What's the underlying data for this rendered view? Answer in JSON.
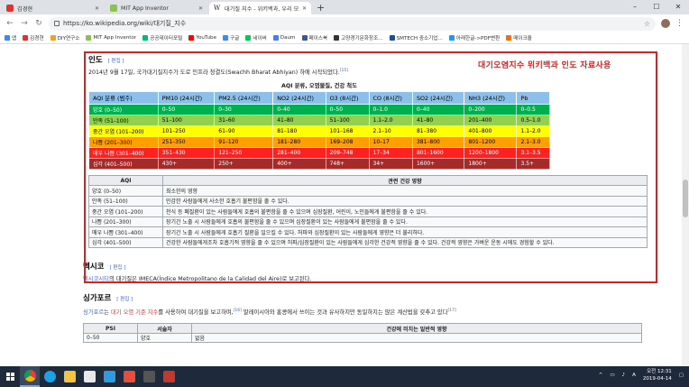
{
  "tabs": [
    {
      "label": "김경현",
      "color": "#d33"
    },
    {
      "label": "MIT App Inventor",
      "color": "#8bc34a"
    },
    {
      "label": "대기질 지수 - 위키백과, 우리 모",
      "color": "#222"
    }
  ],
  "toolbar": {
    "url": "https://ko.wikipedia.org/wiki/대기질_지수"
  },
  "bookmarks": [
    {
      "label": "앱",
      "color": "#4285f4"
    },
    {
      "label": "김경현",
      "color": "#d33"
    },
    {
      "label": "DIY연구소",
      "color": "#f4a020"
    },
    {
      "label": "MIT App Inventor",
      "color": "#8bc34a"
    },
    {
      "label": "공공데이터포털",
      "color": "#0b7"
    },
    {
      "label": "YouTube",
      "color": "#f00"
    },
    {
      "label": "구글",
      "color": "#4285f4"
    },
    {
      "label": "네이버",
      "color": "#03c75a"
    },
    {
      "label": "Daum",
      "color": "#4a79ff"
    },
    {
      "label": "페이스북",
      "color": "#3b5998"
    },
    {
      "label": "고양경기문화창조...",
      "color": "#333"
    },
    {
      "label": "SMTECH 중소기업...",
      "color": "#1a4f9c"
    },
    {
      "label": "아래한글->PDF변환",
      "color": "#2196f3"
    },
    {
      "label": "메이크올",
      "color": "#ff6d00"
    }
  ],
  "annotation": "대기오염지수 위키백과 인도 자료사용",
  "india": {
    "title": "인도",
    "edit": "[ 편집 ]",
    "text": "2014년 9월 17일, 국가대기질지수가 도로 인프라 청결도(Swachh Bharat Abhiyan) 하에 시작되었다.",
    "ref": "[15]",
    "table_title": "AQI 분류, 오염물질, 건강 척도",
    "headers": [
      "AQI 분류 (범주)",
      "PM10 (24시간)",
      "PM2.5 (24시간)",
      "NO2 (24시간)",
      "O3 (8시간)",
      "CO (8시간)",
      "SO2 (24시간)",
      "NH3 (24시간)",
      "Pb"
    ],
    "rows": [
      {
        "cells": [
          "양호 (0–50)",
          "0–50",
          "0–30",
          "0–40",
          "0–50",
          "0–1.0",
          "0–40",
          "0–200",
          "0–0.5"
        ],
        "bg": "#00b050",
        "fg": "#fff"
      },
      {
        "cells": [
          "만족 (51–100)",
          "51–100",
          "31–60",
          "41–80",
          "51–100",
          "1.1–2.0",
          "41–80",
          "201–400",
          "0.5–1.0"
        ],
        "bg": "#92d050",
        "fg": "#000"
      },
      {
        "cells": [
          "중간 오염 (101–200)",
          "101–250",
          "61–90",
          "81–180",
          "101–168",
          "2.1–10",
          "81–380",
          "401–800",
          "1.1–2.0"
        ],
        "bg": "#ffff00",
        "fg": "#000"
      },
      {
        "cells": [
          "나쁨 (201–300)",
          "251–350",
          "91–120",
          "181–280",
          "169–208",
          "10–17",
          "381–800",
          "801–1200",
          "2.1–3.0"
        ],
        "bg": "#ffa000",
        "fg": "#000"
      },
      {
        "cells": [
          "매우 나쁨 (301–400)",
          "351–430",
          "121–250",
          "281–400",
          "209–748",
          "17–34",
          "801–1600",
          "1200–1800",
          "3.1–3.5"
        ],
        "bg": "#ff2020",
        "fg": "#fff"
      },
      {
        "cells": [
          "심각 (401–500)",
          "430+",
          "250+",
          "400+",
          "748+",
          "34+",
          "1600+",
          "1800+",
          "3.5+"
        ],
        "bg": "#a52a2a",
        "fg": "#fff"
      }
    ],
    "effects_headers": [
      "AQI",
      "관련 건강 영향"
    ],
    "effects": [
      [
        "양호 (0–50)",
        "최소한의 영향"
      ],
      [
        "만족 (51–100)",
        "민감한 사람들에게 사소한 호흡기 불편함을 줄 수 있다."
      ],
      [
        "중간 오염 (101–200)",
        "천식 등 폐질환이 있는 사람들에게 호흡의 불편함을 줄 수 있으며 심장질환, 어린이, 노인들에게 불편함을 줄 수 있다."
      ],
      [
        "나쁨 (201–300)",
        "장기간 노출 시 사람들에게 호흡의 불편함을 줄 수 있으며 심장질환이 있는 사람들에게 불편함을 줄 수 있다."
      ],
      [
        "매우 나쁨 (301–400)",
        "장기간 노출 시 사람들에게 호흡기 질환을 일으킬 수 있다. 허파와 심장질환이 있는 사람들에게 영향은 더 불리하다."
      ],
      [
        "심각 (401–500)",
        "건강한 사람들에게조차 호흡기적 영향을 줄 수 있으며 허파/심장질환이 있는 사람들에게 심각한 건강적 영향을 줄 수 있다. 건강적 영향은 가벼운 운동 시에도 경험할 수 있다."
      ]
    ]
  },
  "mexico": {
    "title": "멕시코",
    "edit": "[ 편집 ]",
    "link": "멕시코시티",
    "text": "의 대기질은 IMECA(Índice Metropolitano de la Calidad del Aire)로 보고된다."
  },
  "singapore": {
    "title": "싱가포르",
    "edit": "[ 편집 ]",
    "link1": "싱가포르",
    "t1": "는 ",
    "link2": "대기 오염 기준 지수",
    "t2": "를 사용하여 대기질을 보고하며,",
    "ref1": "[16]",
    "t3": " 말레이시아와 홍콩에서 쓰이는 것과 유사하지만 동일하지는 않은 계산법을 갖추고 있다",
    "ref2": "[17]",
    "psi_headers": [
      "PSI",
      "서술자",
      "건강에 미치는 일반적 영향"
    ],
    "psi_row": [
      "0–50",
      "양호",
      "없음"
    ]
  },
  "taskbar": {
    "time": "오전 12:31",
    "date": "2019-04-14",
    "lang": "A"
  }
}
